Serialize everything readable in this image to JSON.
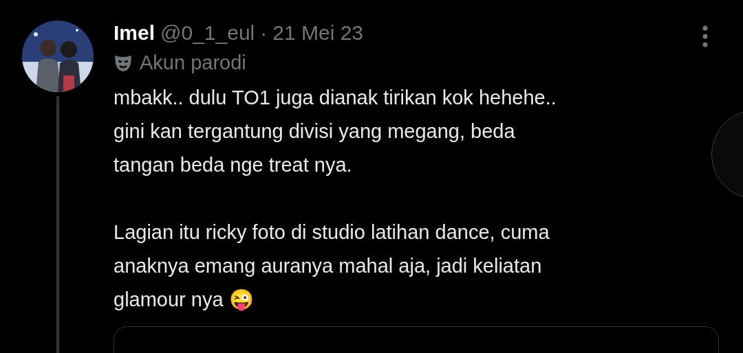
{
  "tweet": {
    "name": "Imel",
    "handle": "@0_1_eul",
    "separator": "·",
    "date": "21 Mei 23",
    "label": "Akun parodi",
    "paragraphs": [
      {
        "lines": [
          "mbakk.. dulu TO1 juga dianak tirikan kok hehehe..",
          "gini kan tergantung divisi yang megang, beda",
          "tangan beda nge treat nya."
        ]
      },
      {
        "lines": [
          "Lagian itu ricky foto di studio latihan dance, cuma",
          "anaknya emang auranya mahal aja, jadi keliatan",
          "glamour nya 😜"
        ]
      }
    ]
  }
}
